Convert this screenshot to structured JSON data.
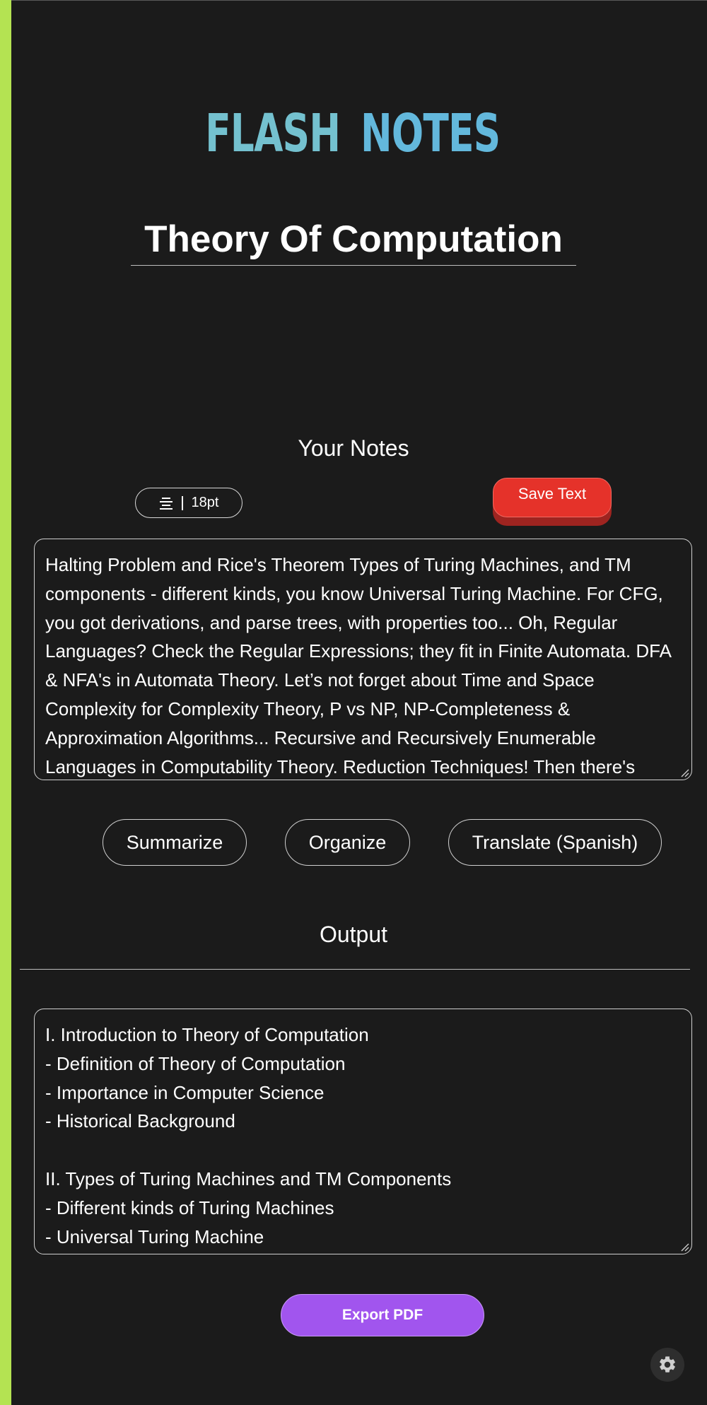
{
  "app": {
    "logo_left": "FLASH",
    "logo_right": "NOTES",
    "logo_icon": "lightning-bolt-icon",
    "accent_stripe_color": "#b4e352"
  },
  "page": {
    "title": "Theory Of Computation"
  },
  "notes": {
    "heading": "Your Notes",
    "font_size_label": "18pt",
    "font_size_icon": "text-align-center-icon",
    "save_label": "Save Text",
    "text": "Halting Problem and Rice's Theorem Types of Turing Machines, and TM components - different kinds, you know Universal Turing Machine. For CFG, you got derivations, and parse trees, with properties too... Oh, Regular Languages? Check the Regular Expressions; they fit in Finite Automata. DFA & NFA's in Automata Theory. Let’s not forget about Time and Space Complexity for Complexity Theory, P vs NP, NP-Completeness & Approximation Algorithms... Recursive and Recursively Enumerable Languages in Computability Theory. Reduction Techniques! Then there's"
  },
  "actions": {
    "summarize": "Summarize",
    "organize": "Organize",
    "translate": "Translate (Spanish)"
  },
  "output": {
    "heading": "Output",
    "lines": [
      "I. Introduction to Theory of Computation",
      "- Definition of Theory of Computation",
      "- Importance in Computer Science",
      "- Historical Background",
      "",
      "II. Types of Turing Machines and TM Components",
      "- Different kinds of Turing Machines",
      "- Universal Turing Machine"
    ],
    "export_label": "Export PDF"
  },
  "colors": {
    "background": "#1b1b1b",
    "save_button": "#e5322a",
    "export_button": "#a155ee",
    "logo_flash": "#74c1cf",
    "logo_notes": "#63b8dc"
  },
  "settings_icon": "gear-icon"
}
